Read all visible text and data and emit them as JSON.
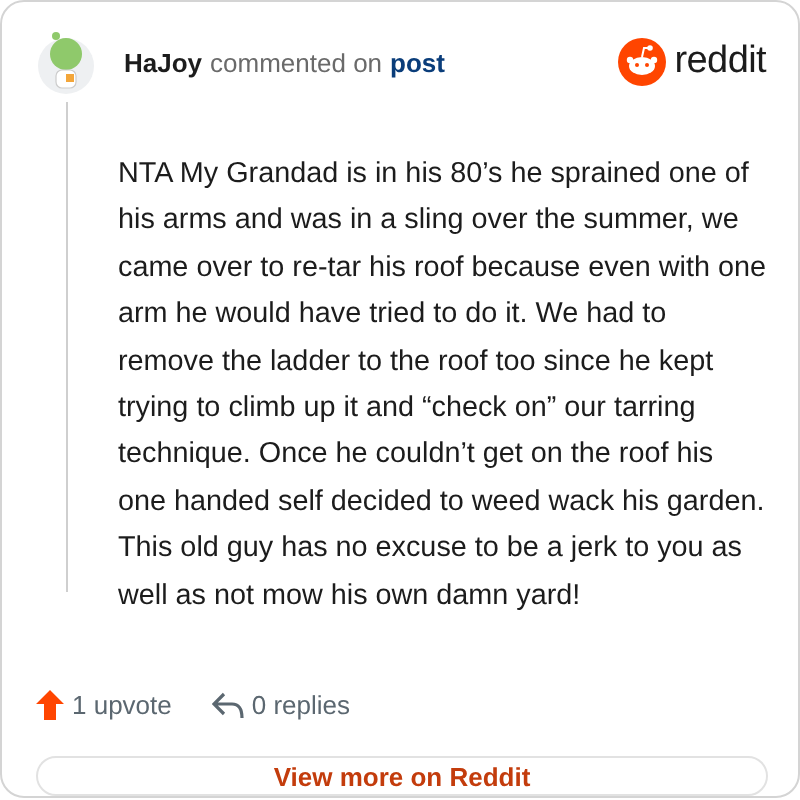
{
  "header": {
    "username": "HaJoy",
    "action": "commented on",
    "link": "post",
    "brand": "reddit"
  },
  "comment": "NTA My Grandad is in his 80’s he sprained one of his arms and was in a sling over the summer, we came over to re-tar his roof because even with one arm he would have tried to do it. We had to remove the ladder to the roof too since he kept trying to climb up it and “check on” our tarring technique. Once he couldn’t get on the roof his one handed self decided to weed wack his garden. This old guy has no excuse to be a jerk to you as well as not mow his own damn yard!",
  "footer": {
    "upvotes": "1 upvote",
    "replies": "0 replies"
  },
  "button": "View more on Reddit"
}
